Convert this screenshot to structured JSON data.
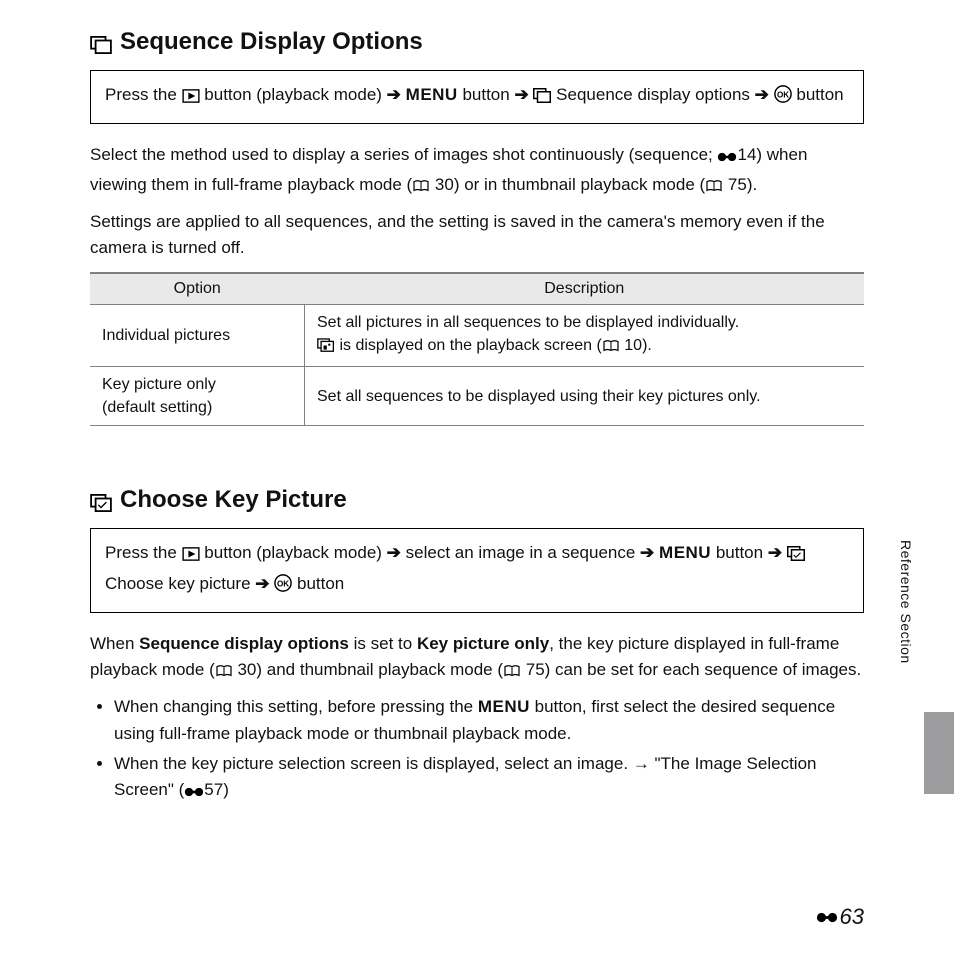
{
  "section1": {
    "title": "Sequence Display Options",
    "nav_parts": {
      "p1": "Press the",
      "p2": "button (playback mode)",
      "p3": "button",
      "p4": "Sequence display options",
      "p5": "button"
    },
    "para1_a": "Select the method used to display a series of images shot continuously (sequence;",
    "para1_b": "14) when viewing them in full-frame playback mode (",
    "para1_c": "30) or in thumbnail playback mode (",
    "para1_d": "75).",
    "para2": "Settings are applied to all sequences, and the setting is saved in the camera's memory even if the camera is turned off.",
    "table": {
      "h1": "Option",
      "h2": "Description",
      "r1c1": "Individual pictures",
      "r1c2a": "Set all pictures in all sequences to be displayed individually.",
      "r1c2b": "is displayed on the playback screen (",
      "r1c2c": "10).",
      "r2c1a": "Key picture only",
      "r2c1b": "(default setting)",
      "r2c2": "Set all sequences to be displayed using their key pictures only."
    }
  },
  "section2": {
    "title": "Choose Key Picture",
    "nav_parts": {
      "p1": "Press the",
      "p2": "button (playback mode)",
      "p3": "select an image in a sequence",
      "p4": "button",
      "p5": "Choose key picture",
      "p6": "button"
    },
    "para1_a": "When",
    "para1_b": "Sequence display options",
    "para1_c": "is set to",
    "para1_d": "Key picture only",
    "para1_e": ", the key picture displayed in full-frame playback mode (",
    "para1_f": "30) and thumbnail playback mode (",
    "para1_g": "75) can be set for each sequence of images.",
    "bullet1a": "When changing this setting, before pressing the",
    "bullet1b": "button, first select the desired sequence using full-frame playback mode or thumbnail playback mode.",
    "bullet2a": "When the key picture selection screen is displayed, select an image.",
    "bullet2b": "\"The Image Selection Screen\" (",
    "bullet2c": "57)"
  },
  "side_label": "Reference Section",
  "page_number": "63",
  "menu_label": "MENU"
}
